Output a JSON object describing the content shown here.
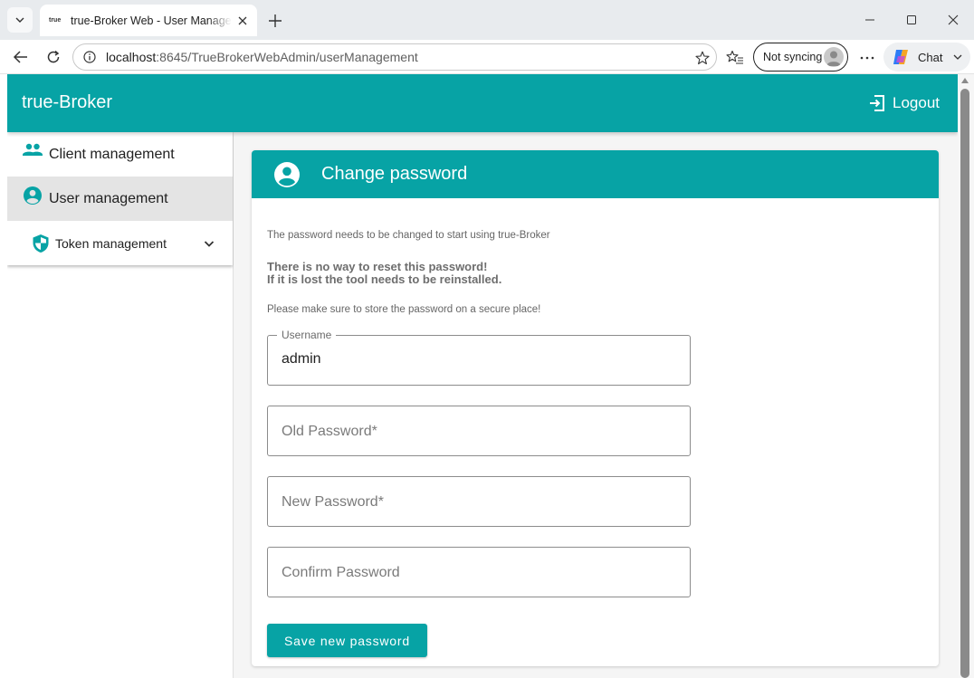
{
  "browser": {
    "tab_title": "true-Broker Web - User Management",
    "tab_favicon_text": "true",
    "url_host": "localhost",
    "url_path": ":8645/TrueBrokerWebAdmin/userManagement",
    "sync_label": "Not syncing",
    "chat_label": "Chat"
  },
  "app": {
    "brand": "true-Broker",
    "logout_label": "Logout",
    "accent_color": "#07a3a5"
  },
  "sidebar": {
    "items": [
      {
        "label": "Client management",
        "icon": "people-icon",
        "active": false
      },
      {
        "label": "User management",
        "icon": "account-circle-icon",
        "active": true
      },
      {
        "label": "Token management",
        "icon": "shield-icon",
        "active": false,
        "expandable": true
      }
    ]
  },
  "card": {
    "title": "Change password",
    "info_text": "The password needs to be changed to start using true-Broker",
    "warning_line1": "There is no way to reset this password!",
    "warning_line2": "If it is lost the tool needs to be reinstalled.",
    "store_text": "Please make sure to store the password on a secure place!",
    "username_label": "Username",
    "username_value": "admin",
    "old_password_placeholder": "Old Password*",
    "new_password_placeholder": "New Password*",
    "confirm_password_placeholder": "Confirm Password",
    "save_label": "Save new password"
  }
}
